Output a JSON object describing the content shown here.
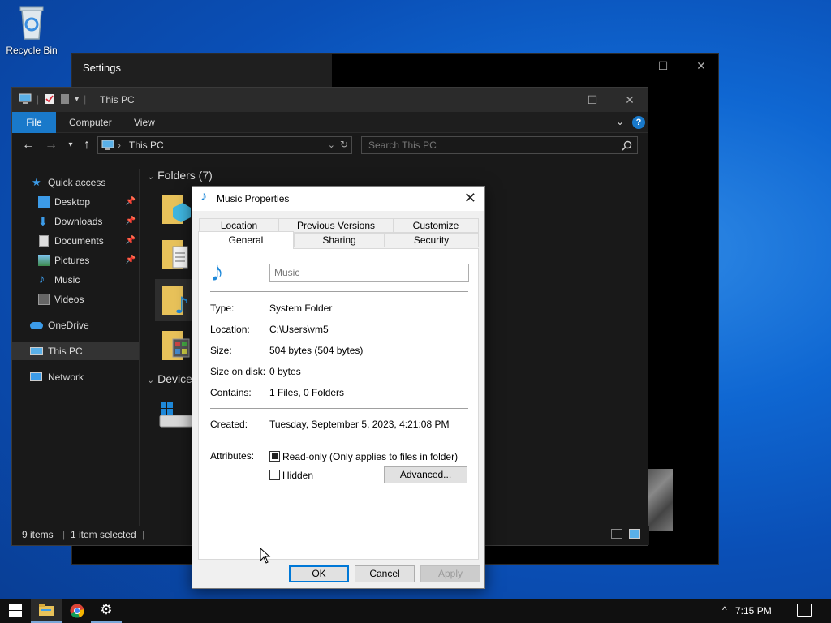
{
  "desktop": {
    "recycle_bin_label": "Recycle Bin"
  },
  "settings_window": {
    "title": "Settings",
    "minimize": "—",
    "maximize": "☐",
    "close": "✕"
  },
  "explorer": {
    "title": "This PC",
    "minimize": "—",
    "maximize": "☐",
    "close": "✕",
    "ribbon_tabs": [
      "File",
      "Computer",
      "View"
    ],
    "address": "This PC",
    "search_placeholder": "Search This PC",
    "nav": {
      "quick_access": "Quick access",
      "desktop": "Desktop",
      "downloads": "Downloads",
      "documents": "Documents",
      "pictures": "Pictures",
      "music": "Music",
      "videos": "Videos",
      "onedrive": "OneDrive",
      "this_pc": "This PC",
      "network": "Network"
    },
    "groups": {
      "folders": "Folders (7)",
      "devices": "Device"
    },
    "status": {
      "items": "9 items",
      "selected": "1 item selected"
    }
  },
  "dialog": {
    "title": "Music Properties",
    "close": "✕",
    "tabs_back": [
      "Location",
      "Previous Versions",
      "Customize"
    ],
    "tabs_front": [
      "General",
      "Sharing",
      "Security"
    ],
    "name_field": "Music",
    "props": {
      "type_label": "Type:",
      "type_value": "System Folder",
      "location_label": "Location:",
      "location_value": "C:\\Users\\vm5",
      "size_label": "Size:",
      "size_value": "504 bytes (504 bytes)",
      "size_on_disk_label": "Size on disk:",
      "size_on_disk_value": "0 bytes",
      "contains_label": "Contains:",
      "contains_value": "1 Files, 0 Folders",
      "created_label": "Created:",
      "created_value": "Tuesday, September 5, 2023, 4:21:08 PM",
      "attributes_label": "Attributes:"
    },
    "attributes": {
      "readonly_label": "Read-only (Only applies to files in folder)",
      "readonly_checked": true,
      "hidden_label": "Hidden",
      "hidden_checked": false,
      "advanced_button": "Advanced..."
    },
    "buttons": {
      "ok": "OK",
      "cancel": "Cancel",
      "apply": "Apply"
    }
  },
  "taskbar": {
    "time": "7:15 PM",
    "tray_chevron": "^"
  },
  "colors": {
    "accent": "#1979ca",
    "music_icon": "#1e88d9"
  }
}
